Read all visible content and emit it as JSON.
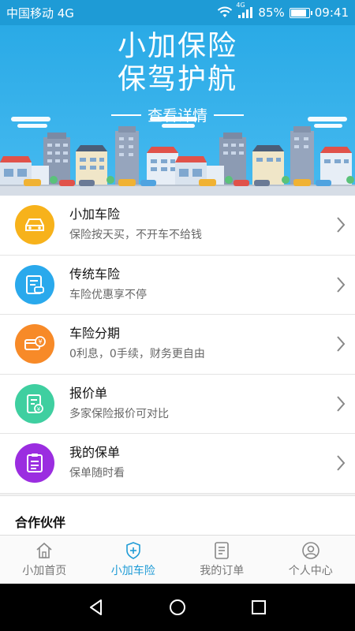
{
  "status_bar": {
    "carrier": "中国移动 4G",
    "network": "4G",
    "battery": "85%",
    "battery_level": 0.85,
    "time": "09:41"
  },
  "banner": {
    "title_line1": "小加保险",
    "title_line2": "保驾护航",
    "link": "查看详情"
  },
  "list": [
    {
      "name": "小加车险",
      "desc": "保险按天买，不开车不给钱",
      "icon": "car-icon",
      "color": "#f7b21b"
    },
    {
      "name": "传统车险",
      "desc": "车险优惠享不停",
      "icon": "document-car-icon",
      "color": "#2aa9ec"
    },
    {
      "name": "车险分期",
      "desc": "0利息，0手续，财务更自由",
      "icon": "yuan-card-icon",
      "color": "#f78a28"
    },
    {
      "name": "报价单",
      "desc": "多家保险报价可对比",
      "icon": "quote-doc-icon",
      "color": "#3fcfa0"
    },
    {
      "name": "我的保单",
      "desc": "保单随时看",
      "icon": "policy-icon",
      "color": "#9b2de0"
    }
  ],
  "partners": {
    "title": "合作伙伴"
  },
  "tabs": [
    {
      "label": "小加首页",
      "icon": "home-icon"
    },
    {
      "label": "小加车险",
      "icon": "shield-icon"
    },
    {
      "label": "我的订单",
      "icon": "order-icon"
    },
    {
      "label": "个人中心",
      "icon": "person-icon"
    }
  ],
  "active_tab": "小加车险",
  "colors": {
    "accent": "#1e9bd6"
  }
}
